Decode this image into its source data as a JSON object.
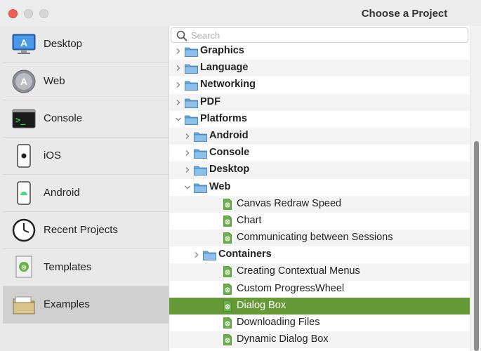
{
  "window": {
    "title": "Choose a Project"
  },
  "sidebar": {
    "items": [
      {
        "label": "Desktop",
        "icon": "desktop-app-icon"
      },
      {
        "label": "Web",
        "icon": "web-app-icon"
      },
      {
        "label": "Console",
        "icon": "terminal-icon"
      },
      {
        "label": "iOS",
        "icon": "iphone-icon"
      },
      {
        "label": "Android",
        "icon": "android-phone-icon"
      },
      {
        "label": "Recent Projects",
        "icon": "clock-icon"
      },
      {
        "label": "Templates",
        "icon": "template-document-icon"
      },
      {
        "label": "Examples",
        "icon": "folder-icon",
        "selected": true
      }
    ]
  },
  "search": {
    "placeholder": "Search",
    "value": ""
  },
  "tree": [
    {
      "label": "Graphics",
      "type": "folder",
      "depth": 0,
      "expanded": false
    },
    {
      "label": "Language",
      "type": "folder",
      "depth": 0,
      "expanded": false
    },
    {
      "label": "Networking",
      "type": "folder",
      "depth": 0,
      "expanded": false
    },
    {
      "label": "PDF",
      "type": "folder",
      "depth": 0,
      "expanded": false
    },
    {
      "label": "Platforms",
      "type": "folder",
      "depth": 0,
      "expanded": true
    },
    {
      "label": "Android",
      "type": "folder",
      "depth": 1,
      "expanded": false
    },
    {
      "label": "Console",
      "type": "folder",
      "depth": 1,
      "expanded": false
    },
    {
      "label": "Desktop",
      "type": "folder",
      "depth": 1,
      "expanded": false
    },
    {
      "label": "Web",
      "type": "folder",
      "depth": 1,
      "expanded": true
    },
    {
      "label": "Canvas Redraw Speed",
      "type": "project",
      "depth": 2
    },
    {
      "label": "Chart",
      "type": "project",
      "depth": 2
    },
    {
      "label": "Communicating between Sessions",
      "type": "project",
      "depth": 2
    },
    {
      "label": "Containers",
      "type": "folder",
      "depth": 2,
      "expanded": false
    },
    {
      "label": "Creating Contextual Menus",
      "type": "project",
      "depth": 2
    },
    {
      "label": "Custom ProgressWheel",
      "type": "project",
      "depth": 2
    },
    {
      "label": "Dialog Box",
      "type": "project",
      "depth": 2,
      "selected": true
    },
    {
      "label": "Downloading Files",
      "type": "project",
      "depth": 2
    },
    {
      "label": "Dynamic Dialog Box",
      "type": "project",
      "depth": 2
    }
  ],
  "colors": {
    "selection": "#659a36",
    "folder": "#7fb4e0",
    "project_icon": "#6bb04a"
  }
}
